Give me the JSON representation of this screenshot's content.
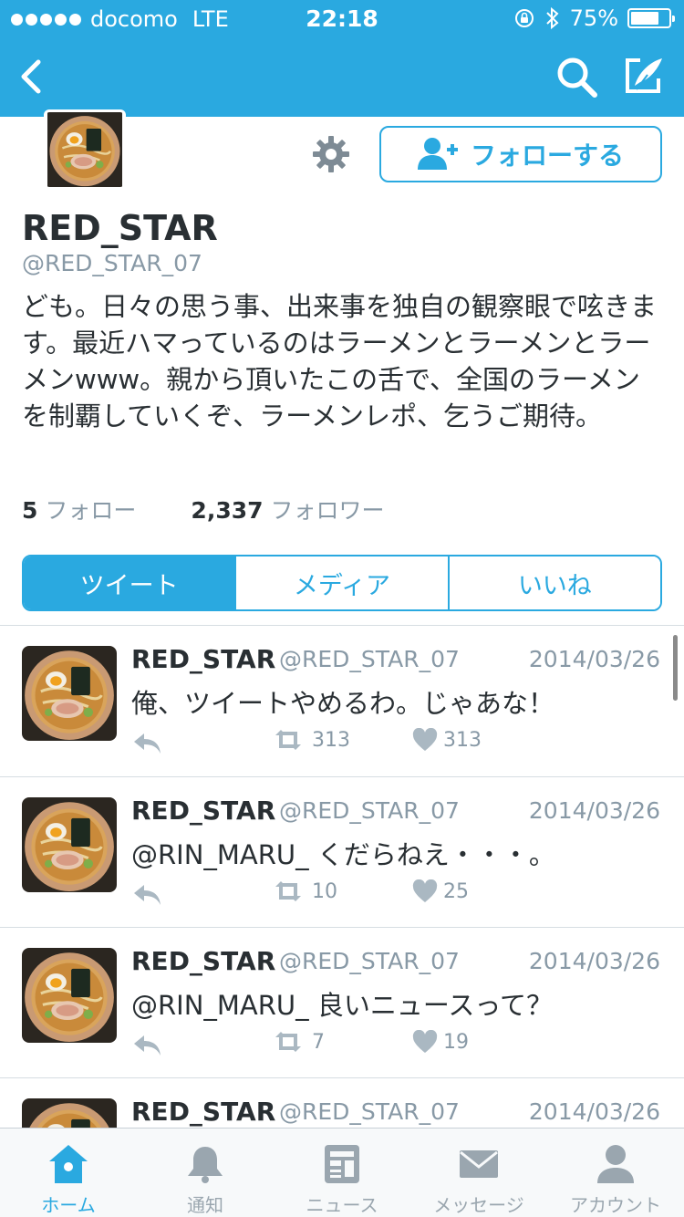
{
  "colors": {
    "accent": "#2aa9e0",
    "muted": "#8899a6",
    "text": "#292f33",
    "tab_inactive": "#9aa6af"
  },
  "status_bar": {
    "carrier": "docomo",
    "network": "LTE",
    "time": "22:18",
    "battery": "75%",
    "battery_level": 0.75,
    "icons": [
      "rotation-lock-icon",
      "bluetooth-icon"
    ]
  },
  "nav": {
    "icons": [
      "back-arrow-icon",
      "search-icon",
      "compose-icon"
    ]
  },
  "profile": {
    "name": "RED_STAR",
    "handle": "@RED_STAR_07",
    "bio": "ども。日々の思う事、出来事を独自の観察眼で呟きます。最近ハマっているのはラーメンとラーメンとラーメンwww。親から頂いたこの舌で、全国のラーメンを制覇していくぞ、ラーメンレポ、乞うご期待。",
    "follow_button": "フォローする",
    "following_count": "5",
    "following_label": "フォロー",
    "followers_count": "2,337",
    "followers_label": "フォロワー"
  },
  "segments": [
    {
      "label": "ツイート",
      "active": true
    },
    {
      "label": "メディア",
      "active": false
    },
    {
      "label": "いいね",
      "active": false
    }
  ],
  "tweets": [
    {
      "name": "RED_STAR",
      "handle": "@RED_STAR_07",
      "date": "2014/03/26",
      "text": "俺、ツイートやめるわ。じゃあな！",
      "retweets": "313",
      "likes": "313"
    },
    {
      "name": "RED_STAR",
      "handle": "@RED_STAR_07",
      "date": "2014/03/26",
      "text": "@RIN_MARU_ くだらねえ・・・。",
      "retweets": "10",
      "likes": "25"
    },
    {
      "name": "RED_STAR",
      "handle": "@RED_STAR_07",
      "date": "2014/03/26",
      "text": "@RIN_MARU_ 良いニュースって？",
      "retweets": "7",
      "likes": "19"
    },
    {
      "name": "RED_STAR",
      "handle": "@RED_STAR_07",
      "date": "2014/03/26"
    }
  ],
  "tabbar": [
    {
      "label": "ホーム",
      "icon": "home-icon",
      "active": true
    },
    {
      "label": "通知",
      "icon": "bell-icon",
      "active": false
    },
    {
      "label": "ニュース",
      "icon": "news-icon",
      "active": false
    },
    {
      "label": "メッセージ",
      "icon": "envelope-icon",
      "active": false
    },
    {
      "label": "アカウント",
      "icon": "person-icon",
      "active": false
    }
  ]
}
